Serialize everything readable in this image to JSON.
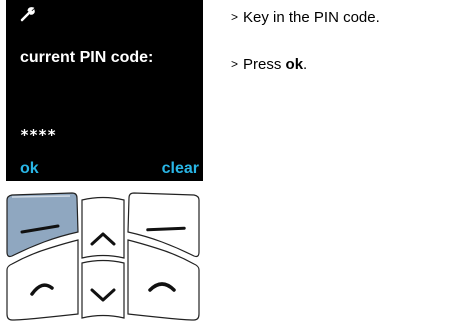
{
  "screen": {
    "icon": "wrench-icon",
    "title": "current PIN code:",
    "pin_mask": "****",
    "softkey_left": "ok",
    "softkey_right": "clear"
  },
  "instructions": [
    {
      "text": "Key in the PIN code.",
      "bold": "",
      "suffix": ""
    },
    {
      "text": "Press ",
      "bold": "ok",
      "suffix": "."
    }
  ],
  "keypad": {
    "highlighted_key": "left-softkey",
    "highlight_color": "#8fa7c0"
  }
}
